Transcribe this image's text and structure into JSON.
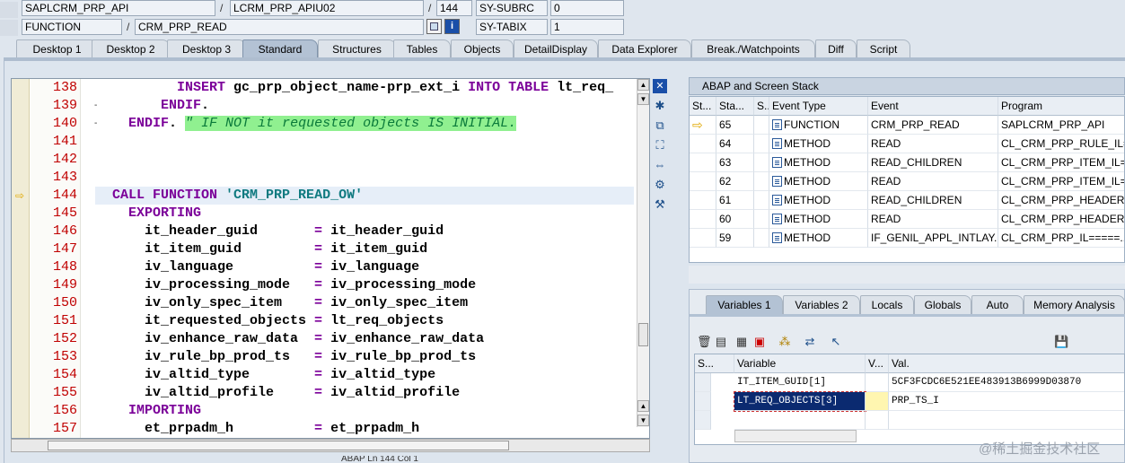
{
  "header": {
    "row1": {
      "program": "SAPLCRM_PRP_API",
      "include": "LCRM_PRP_APIU02",
      "line": "144",
      "var_name": "SY-SUBRC",
      "var_value": "0"
    },
    "row2": {
      "type": "FUNCTION",
      "name": "CRM_PRP_READ",
      "var_name": "SY-TABIX",
      "var_value": "1"
    },
    "sep": "/"
  },
  "tabs": [
    "Desktop 1",
    "Desktop 2",
    "Desktop 3",
    "Standard",
    "Structures",
    "Tables",
    "Objects",
    "DetailDisplay",
    "Data Explorer",
    "Break./Watchpoints",
    "Diff",
    "Script"
  ],
  "active_tab": "Standard",
  "editor": {
    "lines": [
      {
        "num": "138",
        "parts": [
          [
            "t",
            "    "
          ],
          [
            "kw",
            "INSERT"
          ],
          [
            "t",
            " gc_prp_object_name-prp_ext_i "
          ],
          [
            "kw",
            "INTO TABLE"
          ],
          [
            "t",
            " lt_req_"
          ]
        ]
      },
      {
        "num": "139",
        "parts": [
          [
            "t",
            "  "
          ],
          [
            "kw",
            "ENDIF"
          ],
          [
            "t",
            "."
          ]
        ]
      },
      {
        "num": "140",
        "parts": [
          [
            "kw",
            "ENDIF"
          ],
          [
            "t",
            ". "
          ],
          [
            "cmt",
            "\" IF NOT it requested objects IS INITIAL."
          ]
        ]
      },
      {
        "num": "141",
        "parts": []
      },
      {
        "num": "142",
        "parts": []
      },
      {
        "num": "143",
        "parts": []
      },
      {
        "num": "144",
        "parts": [
          [
            "kw",
            "CALL FUNCTION"
          ],
          [
            "t",
            " "
          ],
          [
            "str",
            "'CRM_PRP_READ_OW'"
          ]
        ]
      },
      {
        "num": "145",
        "parts": [
          [
            "t",
            "  "
          ],
          [
            "kw",
            "EXPORTING"
          ]
        ]
      },
      {
        "num": "146",
        "parts": [
          [
            "t",
            "    it_header_guid       "
          ],
          [
            "kw",
            "="
          ],
          [
            "t",
            " it_header_guid"
          ]
        ]
      },
      {
        "num": "147",
        "parts": [
          [
            "t",
            "    it_item_guid         "
          ],
          [
            "kw",
            "="
          ],
          [
            "t",
            " it_item_guid"
          ]
        ]
      },
      {
        "num": "148",
        "parts": [
          [
            "t",
            "    iv_language          "
          ],
          [
            "kw",
            "="
          ],
          [
            "t",
            " iv_language"
          ]
        ]
      },
      {
        "num": "149",
        "parts": [
          [
            "t",
            "    iv_processing_mode   "
          ],
          [
            "kw",
            "="
          ],
          [
            "t",
            " iv_processing_mode"
          ]
        ]
      },
      {
        "num": "150",
        "parts": [
          [
            "t",
            "    iv_only_spec_item    "
          ],
          [
            "kw",
            "="
          ],
          [
            "t",
            " iv_only_spec_item"
          ]
        ]
      },
      {
        "num": "151",
        "parts": [
          [
            "t",
            "    it_requested_objects "
          ],
          [
            "kw",
            "="
          ],
          [
            "t",
            " lt_req_objects"
          ]
        ]
      },
      {
        "num": "152",
        "parts": [
          [
            "t",
            "    iv_enhance_raw_data  "
          ],
          [
            "kw",
            "="
          ],
          [
            "t",
            " iv_enhance_raw_data"
          ]
        ]
      },
      {
        "num": "153",
        "parts": [
          [
            "t",
            "    iv_rule_bp_prod_ts   "
          ],
          [
            "kw",
            "="
          ],
          [
            "t",
            " iv_rule_bp_prod_ts"
          ]
        ]
      },
      {
        "num": "154",
        "parts": [
          [
            "t",
            "    iv_altid_type        "
          ],
          [
            "kw",
            "="
          ],
          [
            "t",
            " iv_altid_type"
          ]
        ]
      },
      {
        "num": "155",
        "parts": [
          [
            "t",
            "    iv_altid_profile     "
          ],
          [
            "kw",
            "="
          ],
          [
            "t",
            " iv_altid_profile"
          ]
        ]
      },
      {
        "num": "156",
        "parts": [
          [
            "t",
            "  "
          ],
          [
            "kw",
            "IMPORTING"
          ]
        ]
      },
      {
        "num": "157",
        "parts": [
          [
            "t",
            "    et_prpadm_h          "
          ],
          [
            "kw",
            "="
          ],
          [
            "t",
            " et_prpadm_h"
          ]
        ]
      }
    ],
    "current_line": "144",
    "status_text": "ABAP   Ln 144 Col 1"
  },
  "stack_panel": {
    "title": "ABAP and Screen Stack",
    "columns": [
      "St...",
      "Sta...",
      "S...",
      "Event Type",
      "Event",
      "Program"
    ],
    "rows": [
      {
        "level": "65",
        "event_type": "FUNCTION",
        "event": "CRM_PRP_READ",
        "program": "SAPLCRM_PRP_API",
        "current": true
      },
      {
        "level": "64",
        "event_type": "METHOD",
        "event": "READ",
        "program": "CL_CRM_PRP_RULE_IL=...",
        "current": false
      },
      {
        "level": "63",
        "event_type": "METHOD",
        "event": "READ_CHILDREN",
        "program": "CL_CRM_PRP_ITEM_IL=...",
        "current": false
      },
      {
        "level": "62",
        "event_type": "METHOD",
        "event": "READ",
        "program": "CL_CRM_PRP_ITEM_IL=...",
        "current": false
      },
      {
        "level": "61",
        "event_type": "METHOD",
        "event": "READ_CHILDREN",
        "program": "CL_CRM_PRP_HEADER_I...",
        "current": false
      },
      {
        "level": "60",
        "event_type": "METHOD",
        "event": "READ",
        "program": "CL_CRM_PRP_HEADER_I...",
        "current": false
      },
      {
        "level": "59",
        "event_type": "METHOD",
        "event": "IF_GENIL_APPL_INTLAY...",
        "program": "CL_CRM_PRP_IL=====...",
        "current": false
      }
    ]
  },
  "var_tabs": [
    "Variables 1",
    "Variables 2",
    "Locals",
    "Globals",
    "Auto",
    "Memory Analysis"
  ],
  "active_var_tab": "Variables 1",
  "vars_table": {
    "columns": [
      "S...",
      "Variable",
      "V...",
      "Val."
    ],
    "rows": [
      {
        "variable": "IT_ITEM_GUID[1]",
        "value": "5CF3FCDC6E521EE483913B6999D03870"
      },
      {
        "variable": "LT_REQ_OBJECTS[3]",
        "value": "PRP_TS_I"
      },
      {
        "variable": "",
        "value": ""
      }
    ]
  },
  "watermark": "@稀土掘金技术社区",
  "colors": {
    "keyword": "#7b0099",
    "string": "#107a80",
    "comment_bg": "#90f090",
    "line_number": "#c00000",
    "active_tab": "#b3c2d4"
  }
}
